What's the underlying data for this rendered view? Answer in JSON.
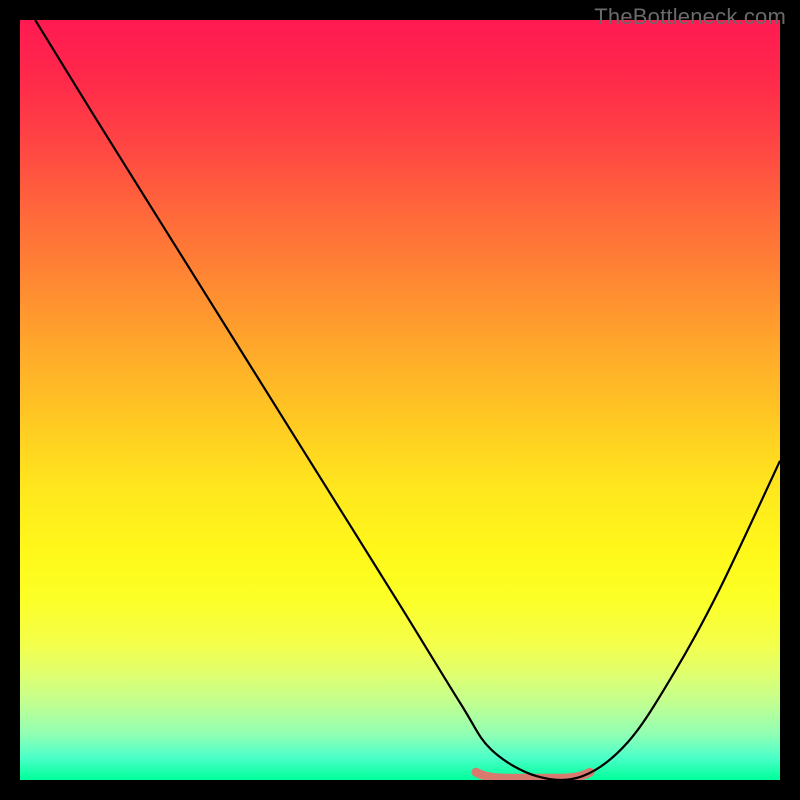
{
  "watermark": "TheBottleneck.com",
  "chart_data": {
    "type": "line",
    "title": "",
    "xlabel": "",
    "ylabel": "",
    "xlim": [
      0,
      100
    ],
    "ylim": [
      0,
      100
    ],
    "series": [
      {
        "name": "curve",
        "x": [
          2,
          10,
          20,
          30,
          40,
          50,
          58,
          62,
          68,
          74,
          80,
          86,
          92,
          100
        ],
        "values": [
          100,
          87,
          71,
          55,
          39,
          23,
          10,
          4,
          0.5,
          0.5,
          5,
          14,
          25,
          42
        ]
      }
    ],
    "annotations": [
      {
        "name": "valley-band",
        "x_start": 60,
        "x_end": 75,
        "y": 0.5,
        "color": "#d97a6f"
      }
    ],
    "colors": {
      "background_top": "#ff1a52",
      "background_bottom": "#00ff9c",
      "curve": "#000000",
      "valley_band": "#d97a6f",
      "frame": "#000000"
    }
  }
}
